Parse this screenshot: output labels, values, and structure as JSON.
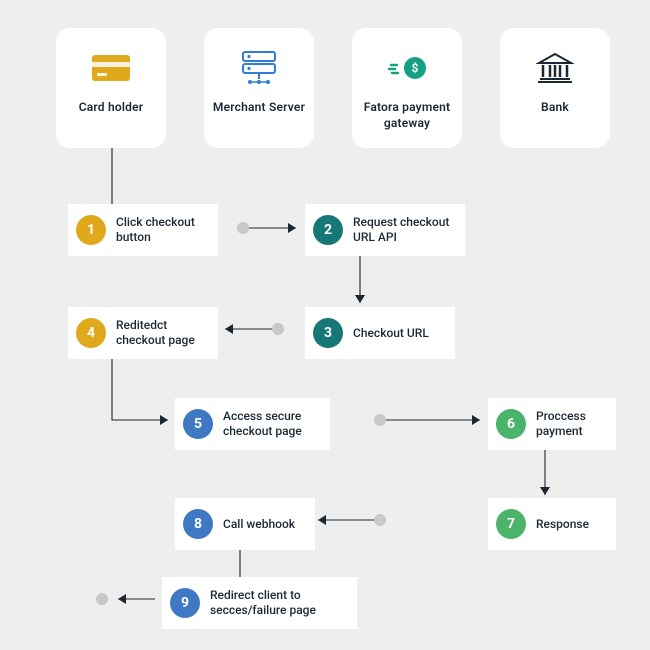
{
  "entities": {
    "cardholder": "Card holder",
    "merchant": "Merchant Server",
    "gateway": "Fatora payment gateway",
    "bank": "Bank"
  },
  "steps": {
    "s1": {
      "n": "1",
      "label": "Click checkout button"
    },
    "s2": {
      "n": "2",
      "label": "Request checkout URL API"
    },
    "s3": {
      "n": "3",
      "label": "Checkout URL"
    },
    "s4": {
      "n": "4",
      "label": "Reditedct checkout page"
    },
    "s5": {
      "n": "5",
      "label": "Access secure checkout page"
    },
    "s6": {
      "n": "6",
      "label": "Proccess payment"
    },
    "s7": {
      "n": "7",
      "label": "Response"
    },
    "s8": {
      "n": "8",
      "label": "Call webhook"
    },
    "s9": {
      "n": "9",
      "label": "Redirect client to secces/failure page"
    }
  },
  "colors": {
    "yellow": "#e0a81b",
    "teal": "#167777",
    "blue": "#3f78c3",
    "green": "#4cb36b",
    "bg": "#edeeed",
    "card": "#ffffff",
    "grey": "#c6c9c8",
    "text": "#1b2834"
  }
}
